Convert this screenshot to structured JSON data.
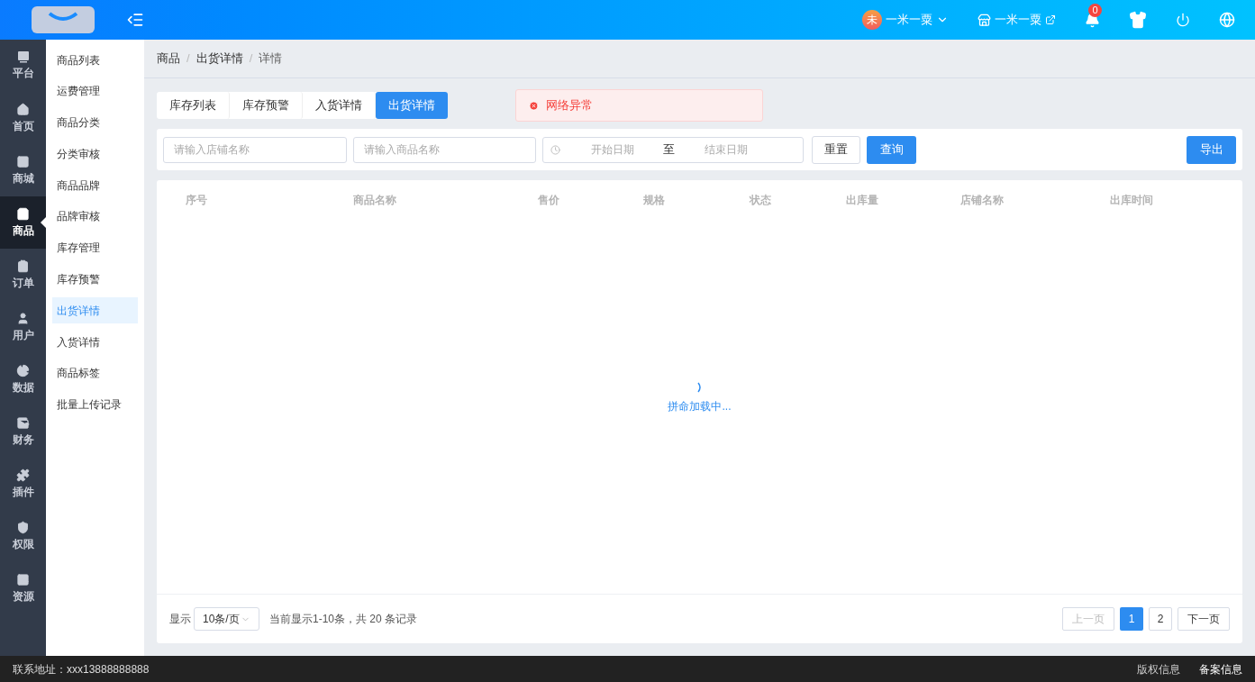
{
  "header": {
    "user": {
      "avatar": "未",
      "name": "一米一粟"
    },
    "shop": {
      "name": "一米一粟"
    },
    "notifications": {
      "count": "0"
    }
  },
  "rail": [
    {
      "label": "平台",
      "selected": false
    },
    {
      "label": "首页",
      "selected": false
    },
    {
      "label": "商城",
      "selected": false
    },
    {
      "label": "商品",
      "selected": true
    },
    {
      "label": "订单",
      "selected": false
    },
    {
      "label": "用户",
      "selected": false
    },
    {
      "label": "数据",
      "selected": false
    },
    {
      "label": "财务",
      "selected": false
    },
    {
      "label": "插件",
      "selected": false
    },
    {
      "label": "权限",
      "selected": false
    },
    {
      "label": "资源",
      "selected": false
    }
  ],
  "submenu": [
    {
      "label": "商品列表",
      "selected": false
    },
    {
      "label": "运费管理",
      "selected": false
    },
    {
      "label": "商品分类",
      "selected": false
    },
    {
      "label": "分类审核",
      "selected": false
    },
    {
      "label": "商品品牌",
      "selected": false
    },
    {
      "label": "品牌审核",
      "selected": false
    },
    {
      "label": "库存管理",
      "selected": false
    },
    {
      "label": "库存预警",
      "selected": false
    },
    {
      "label": "出货详情",
      "selected": true
    },
    {
      "label": "入货详情",
      "selected": false
    },
    {
      "label": "商品标签",
      "selected": false
    },
    {
      "label": "批量上传记录",
      "selected": false
    }
  ],
  "breadcrumb": [
    "商品",
    "出货详情",
    "详情"
  ],
  "breadcrumb_separator": "/",
  "tabs": [
    {
      "label": "库存列表",
      "selected": false
    },
    {
      "label": "库存预警",
      "selected": false
    },
    {
      "label": "入货详情",
      "selected": false
    },
    {
      "label": "出货详情",
      "selected": true
    }
  ],
  "alert": {
    "message": "网络异常"
  },
  "filters": {
    "shop_placeholder": "请输入店铺名称",
    "product_placeholder": "请输入商品名称",
    "start_placeholder": "开始日期",
    "separator": "至",
    "end_placeholder": "结束日期",
    "reset": "重置",
    "search": "查询",
    "export": "导出"
  },
  "table": {
    "columns": [
      "序号",
      "商品名称",
      "售价",
      "规格",
      "状态",
      "出库量",
      "店铺名称",
      "出库时间"
    ],
    "loading_text": "拼命加载中..."
  },
  "pagination": {
    "show_label": "显示",
    "page_size": "10条/页",
    "summary": "当前显示1-10条，共 20 条记录",
    "prev": {
      "label": "上一页",
      "disabled": true
    },
    "pages": [
      {
        "label": "1",
        "selected": true
      },
      {
        "label": "2",
        "selected": false
      }
    ],
    "next": {
      "label": "下一页",
      "disabled": false
    }
  },
  "footer": {
    "contact": "联系地址：xxx13888888888",
    "links": [
      "版权信息",
      "备案信息"
    ]
  }
}
